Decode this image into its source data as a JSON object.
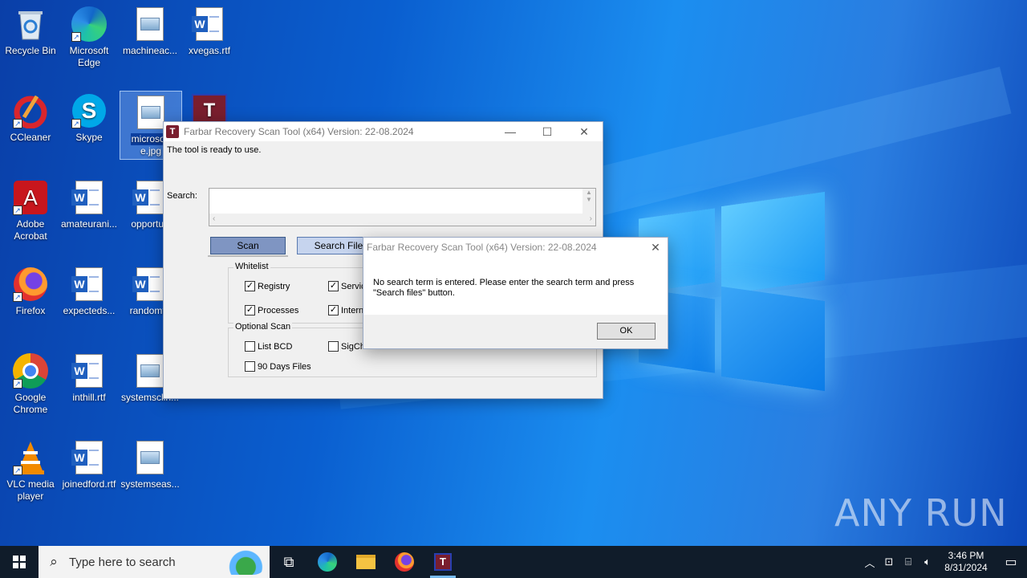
{
  "desktop": {
    "icons": [
      {
        "label": "Recycle Bin"
      },
      {
        "label": "Microsoft Edge"
      },
      {
        "label": "machineac..."
      },
      {
        "label": "xvegas.rtf"
      },
      {
        "label": "CCleaner"
      },
      {
        "label": "Skype"
      },
      {
        "label": "microsoft",
        "label2": "e.jpg"
      },
      {
        "label": ""
      },
      {
        "label": "Adobe Acrobat"
      },
      {
        "label": "amateurani..."
      },
      {
        "label": "opportun"
      },
      {
        "label": "Firefox"
      },
      {
        "label": "expecteds..."
      },
      {
        "label": "randomth"
      },
      {
        "label": "Google Chrome"
      },
      {
        "label": "inthill.rtf"
      },
      {
        "label": "systemsclin..."
      },
      {
        "label": "VLC media player"
      },
      {
        "label": "joinedford.rtf"
      },
      {
        "label": "systemseas..."
      }
    ]
  },
  "frst_window": {
    "title": "Farbar Recovery Scan Tool (x64) Version: 22-08.2024",
    "status": "The tool is ready to use.",
    "search_label": "Search:",
    "search_value": "",
    "scan_button": "Scan",
    "search_files_button": "Search Files",
    "whitelist": {
      "title": "Whitelist",
      "items": [
        {
          "label": "Registry",
          "checked": true
        },
        {
          "label": "Servic",
          "checked": true
        },
        {
          "label": "Processes",
          "checked": true
        },
        {
          "label": "Interne",
          "checked": true
        }
      ]
    },
    "optional_scan": {
      "title": "Optional Scan",
      "items": [
        {
          "label": "List BCD",
          "checked": false
        },
        {
          "label": "SigCheck",
          "checked": false
        },
        {
          "label": "90 Days Files",
          "checked": false
        }
      ]
    }
  },
  "dialog": {
    "title": "Farbar Recovery Scan Tool (x64) Version: 22-08.2024",
    "message_line1": "No search term is entered. Please enter the search term and press",
    "message_line2": "\"Search files\" button.",
    "ok_button": "OK"
  },
  "watermark": "ANY RUN",
  "taskbar": {
    "search_placeholder": "Type here to search",
    "time": "3:46 PM",
    "date": "8/31/2024"
  },
  "colors": {
    "accent": "#76b9ed",
    "taskbar": "#101c2a",
    "app_icon": "#7a1e2e"
  }
}
